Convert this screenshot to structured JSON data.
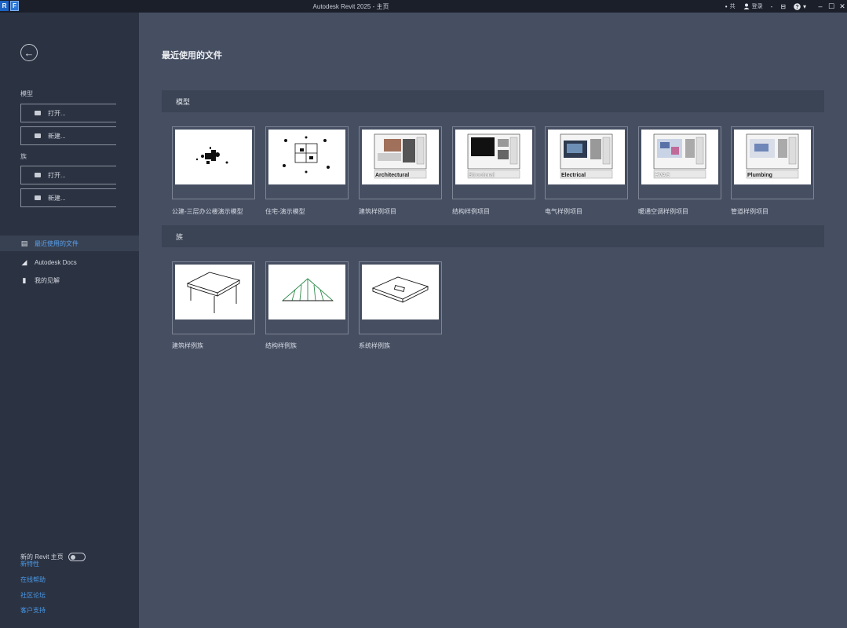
{
  "window": {
    "title": "Autodesk Revit 2025 - 主页",
    "app_icon_1": "R",
    "app_icon_2": "F",
    "share_label": "共",
    "user_label": "登录",
    "min_glyph": "–",
    "max_glyph": "☐",
    "close_glyph": "✕"
  },
  "sidebar": {
    "back_glyph": "←",
    "group1_label": "模型",
    "group1_open": "打开...",
    "group1_new": "新建...",
    "group2_label": "族",
    "group2_open": "打开...",
    "group2_new": "新建...",
    "nav": [
      {
        "label": "最近使用的文件",
        "icon": "recent-files-icon",
        "active": true
      },
      {
        "label": "Autodesk Docs",
        "icon": "autodesk-docs-icon",
        "active": false
      },
      {
        "label": "我的见解",
        "icon": "insights-icon",
        "active": false
      }
    ],
    "toggle_label": "新的 Revit 主页",
    "links": [
      "新特性",
      "在线帮助",
      "社区论坛",
      "客户支持"
    ]
  },
  "main": {
    "title": "最近使用的文件",
    "models_section": "模型",
    "families_section": "族",
    "models": [
      {
        "label": "公建-三层办公楼演示模型",
        "caption": ""
      },
      {
        "label": "住宅-演示模型",
        "caption": ""
      },
      {
        "label": "建筑样例项目",
        "caption": "Architectural"
      },
      {
        "label": "结构样例项目",
        "caption": "Structural"
      },
      {
        "label": "电气样例项目",
        "caption": "Electrical"
      },
      {
        "label": "暖通空调样例项目",
        "caption": "HVAC"
      },
      {
        "label": "管道样例项目",
        "caption": "Plumbing"
      }
    ],
    "families": [
      {
        "label": "建筑样例族"
      },
      {
        "label": "结构样例族"
      },
      {
        "label": "系统样例族"
      }
    ]
  },
  "colors": {
    "sidebar_bg": "#2b3242",
    "main_bg": "#464f62",
    "section_bg": "#3b4455",
    "accent_blue": "#4a9ae8"
  }
}
